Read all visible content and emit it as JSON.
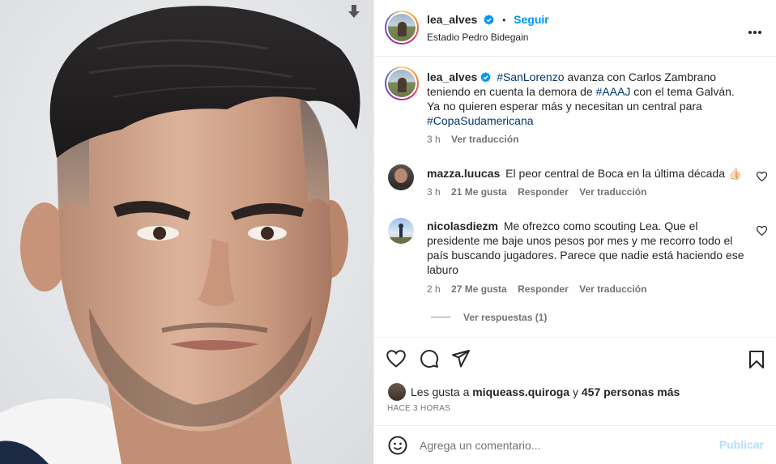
{
  "post": {
    "username": "lea_alves",
    "follow_label": "Seguir",
    "separator": "•",
    "location": "Estadio Pedro Bidegain",
    "more_icon": "more-horizontal-icon",
    "download_icon": "download-arrow-icon"
  },
  "caption": {
    "username": "lea_alves",
    "tag1": "#SanLorenzo",
    "text1": " avanza con Carlos Zambrano teniendo en cuenta la demora de ",
    "tag2": "#AAAJ",
    "text2": " con el tema Galván.",
    "text3": "Ya no quieren esperar más y necesitan un central para ",
    "tag3": "#CopaSudamericana",
    "time": "3 h",
    "translate": "Ver traducción"
  },
  "comments": [
    {
      "username": "mazza.luucas",
      "text": "El peor central de Boca en la última década 👍🏻",
      "time": "3 h",
      "likes": "21 Me gusta",
      "reply": "Responder",
      "translate": "Ver traducción"
    },
    {
      "username": "nicolasdiezm",
      "text": "Me ofrezco como scouting Lea. Que el presidente me baje unos pesos por mes y me recorro todo el país buscando jugadores. Parece que nadie está haciendo ese laburo",
      "time": "2 h",
      "likes": "27 Me gusta",
      "reply": "Responder",
      "translate": "Ver traducción",
      "view_replies": "Ver respuestas (1)"
    }
  ],
  "actions": {
    "icons": [
      "heart-icon",
      "comment-icon",
      "share-icon",
      "bookmark-icon"
    ],
    "likes_prefix": "Les gusta a ",
    "likes_user": "miqueass.quiroga",
    "likes_mid": " y ",
    "likes_count": "457 personas más",
    "timestamp": "HACE 3 HORAS"
  },
  "composer": {
    "placeholder": "Agrega un comentario...",
    "publish_label": "Publicar",
    "emoji_icon": "emoji-icon"
  },
  "colors": {
    "link": "#0095f6",
    "hashtag": "#00376b",
    "muted": "#737373",
    "publish_disabled": "#b2dffc"
  }
}
